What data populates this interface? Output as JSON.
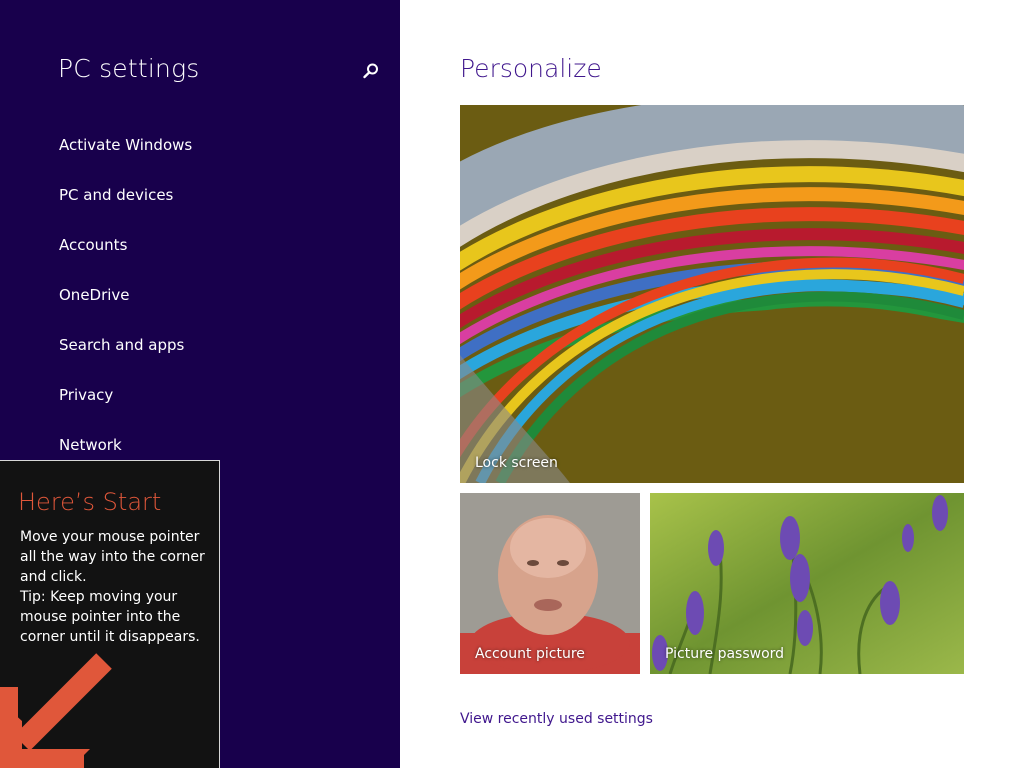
{
  "sidebar": {
    "title": "PC settings",
    "search_icon": "search-icon",
    "items": [
      {
        "label": "Activate Windows"
      },
      {
        "label": "PC and devices"
      },
      {
        "label": "Accounts"
      },
      {
        "label": "OneDrive"
      },
      {
        "label": "Search and apps"
      },
      {
        "label": "Privacy"
      },
      {
        "label": "Network"
      }
    ]
  },
  "tip": {
    "title": "Here’s Start",
    "body_lines": [
      "Move your mouse pointer",
      "all the way into the corner",
      "and click.",
      "Tip: Keep moving your",
      "mouse pointer into the",
      "corner until it disappears."
    ],
    "arrow_icon": "arrow-down-left-icon"
  },
  "main": {
    "title": "Personalize",
    "tiles": [
      {
        "label": "Lock screen"
      },
      {
        "label": "Account picture"
      },
      {
        "label": "Picture password"
      }
    ],
    "link": "View recently used settings"
  },
  "colors": {
    "sidebar_bg": "#18004c",
    "accent": "#40178d",
    "tip_title": "#e0573a"
  }
}
